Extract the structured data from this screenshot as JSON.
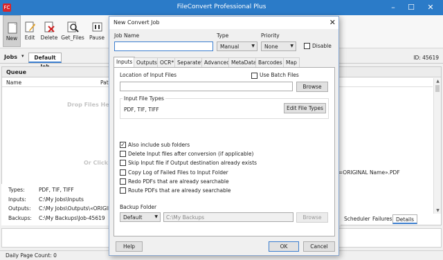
{
  "app": {
    "title": "FileConvert Professional Plus",
    "logo": "FC"
  },
  "ribbon": {
    "new": "New",
    "edit": "Edit",
    "delete": "Delete",
    "get_files": "Get_Files",
    "pause": "Pause"
  },
  "jobs": {
    "label": "Jobs",
    "tab": "Default Job",
    "id": "ID: 45619"
  },
  "queue": {
    "title": "Queue",
    "col_name": "Name",
    "col_path": "Path",
    "drop_text": "Drop Files He",
    "or_click": "Or Click",
    "path_value": "=ORIGINAL Name».PDF"
  },
  "details": {
    "types_k": "Types:",
    "types_v": "PDF, TIF, TIFF",
    "inputs_k": "Inputs:",
    "inputs_v": "C:\\My Jobs\\Inputs",
    "outputs_k": "Outputs:",
    "outputs_v": "C:\\My Jobs\\Outputs\\«ORIGINA",
    "backups_k": "Backups:",
    "backups_v": "C:\\My Backups\\Job-45619"
  },
  "bottom_tabs": {
    "scheduler": "Scheduler",
    "failures": "Failures",
    "details": "Details"
  },
  "status": {
    "daily": "Daily Page Count: 0"
  },
  "dialog": {
    "title": "New Convert Job",
    "job_name_label": "Job Name",
    "job_name_value": "",
    "type_label": "Type",
    "type_value": "Manual",
    "priority_label": "Priority",
    "priority_value": "None",
    "disable_label": "Disable",
    "tabs": [
      "Inputs",
      "Outputs",
      "OCR*",
      "Separate*",
      "Advanced",
      "MetaData",
      "Barcodes",
      "Map"
    ],
    "location_label": "Location of Input Files",
    "batch_label": "Use Batch Files",
    "location_value": "",
    "browse": "Browse",
    "input_types_label": "Input File Types",
    "input_types_value": "PDF, TIF, TIFF",
    "edit_types": "Edit File Types",
    "options": [
      {
        "label": "Also include sub folders",
        "checked": true
      },
      {
        "label": "Delete Input files after conversion (if applicable)",
        "checked": false
      },
      {
        "label": "Skip Input file if Output destination already exists",
        "checked": false
      },
      {
        "label": "Copy Log of Failed Files to Input Folder",
        "checked": false
      },
      {
        "label": "Redo PDFs that are already searchable",
        "checked": false
      },
      {
        "label": "Route PDFs that are already searchable",
        "checked": false
      }
    ],
    "backup_label": "Backup Folder",
    "backup_mode": "Default",
    "backup_path": "C:\\My Backups",
    "backup_browse": "Browse",
    "help": "Help",
    "ok": "OK",
    "cancel": "Cancel"
  }
}
